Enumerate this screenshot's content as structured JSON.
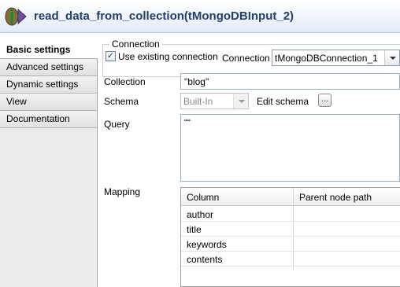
{
  "header": {
    "title": "read_data_from_collection(tMongoDBInput_2)"
  },
  "tabs": [
    {
      "label": "Basic settings",
      "active": true
    },
    {
      "label": "Advanced settings",
      "active": false
    },
    {
      "label": "Dynamic settings",
      "active": false
    },
    {
      "label": "View",
      "active": false
    },
    {
      "label": "Documentation",
      "active": false
    }
  ],
  "connection": {
    "group_title": "Connection",
    "use_existing_label": "Use existing connection",
    "use_existing_checked": true,
    "connection_label": "Connection",
    "connection_value": "tMongoDBConnection_1"
  },
  "collection": {
    "label": "Collection",
    "value": "\"blog\""
  },
  "schema": {
    "label": "Schema",
    "value": "Built-In",
    "edit_label": "Edit schema",
    "dots_label": "..."
  },
  "query": {
    "label": "Query",
    "value": "““"
  },
  "mapping": {
    "label": "Mapping",
    "columns": [
      "Column",
      "Parent node path"
    ],
    "rows": [
      {
        "column": "author",
        "path": ""
      },
      {
        "column": "title",
        "path": ""
      },
      {
        "column": "keywords",
        "path": ""
      },
      {
        "column": "contents",
        "path": ""
      }
    ]
  }
}
